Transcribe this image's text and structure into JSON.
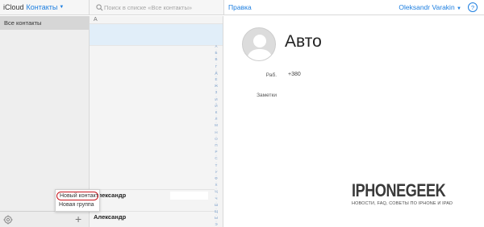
{
  "header": {
    "brand": "iCloud",
    "app_name": "Контакты",
    "search_placeholder": "Поиск в списке «Все контакты»",
    "edit_label": "Правка",
    "user_name": "Oleksandr Varakin",
    "help_label": "?"
  },
  "sidebar": {
    "groups": [
      {
        "label": "Все контакты",
        "selected": true
      }
    ],
    "add_menu": {
      "items": [
        {
          "label": "Новый контакт",
          "highlighted": true
        },
        {
          "label": "Новая группа",
          "highlighted": false
        }
      ]
    }
  },
  "list": {
    "section_letter": "А",
    "rows": [
      {
        "name": "Александр"
      },
      {
        "name": "Александр"
      }
    ],
    "index_letters": [
      "А",
      "Б",
      "В",
      "Г",
      "Д",
      "Е",
      "Ж",
      "З",
      "И",
      "Й",
      "К",
      "Л",
      "М",
      "Н",
      "О",
      "П",
      "Р",
      "С",
      "Т",
      "У",
      "Ф",
      "Х",
      "Ц",
      "Ч",
      "Ш",
      "Щ",
      "Ы",
      "Э"
    ]
  },
  "card": {
    "name": "Авто",
    "fields": [
      {
        "label": "Раб.",
        "value": "+380"
      },
      {
        "label": "Заметки",
        "value": ""
      }
    ]
  },
  "watermark": {
    "logo": "IPHONEGEEK",
    "tagline": "НОВОСТИ, FAQ, СОВЕТЫ ПО IPHONE И IPAD"
  }
}
